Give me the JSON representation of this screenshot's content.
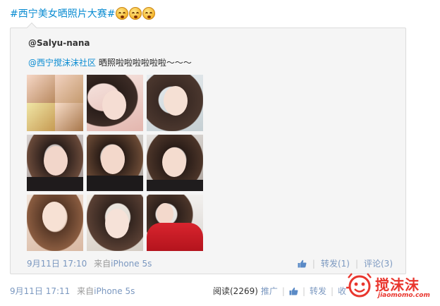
{
  "post": {
    "topic": "#西宁美女晒照片大赛#",
    "emoji_name": "crying-laugh-emoji"
  },
  "repost": {
    "author": "@Salyu-nana",
    "mention": "@西宁搅沫沫社区",
    "text": " 晒照啦啦啦啦啦啦～～～",
    "time": "9月11日 17:10",
    "source_prefix": "来自",
    "source": "iPhone 5s",
    "repost_label": "转发(1)",
    "comment_label": "评论(3)"
  },
  "footer": {
    "time": "9月11日 17:11",
    "source_prefix": "来自",
    "source": "iPhone 5s",
    "read_label": "阅读(2269)",
    "promote_label": "推广",
    "repost_label": "转发",
    "favorite_label": "收"
  },
  "watermark": {
    "brand": "搅沫沫",
    "url": "jiaomomo.com"
  }
}
